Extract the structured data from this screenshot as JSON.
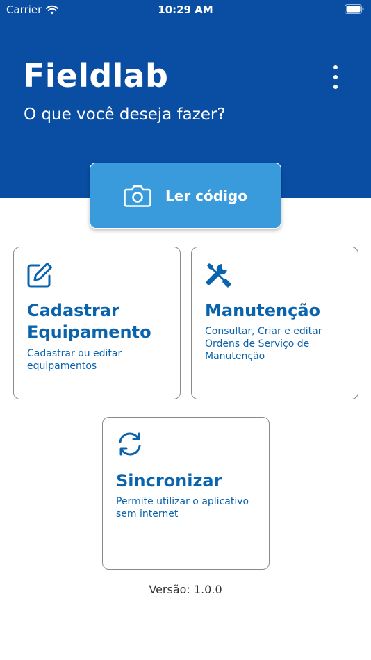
{
  "status_bar": {
    "carrier": "Carrier",
    "time": "10:29 AM"
  },
  "header": {
    "title": "Fieldlab",
    "subtitle": "O que você deseja fazer?"
  },
  "scan_button": {
    "label": "Ler código",
    "icon": "camera-icon"
  },
  "cards": {
    "register": {
      "title_line1": "Cadastrar",
      "title_line2": "Equipamento",
      "desc_line1": "Cadastrar ou editar",
      "desc_line2": "equipamentos",
      "icon": "edit-icon"
    },
    "maintenance": {
      "title": "Manutenção",
      "desc_line1": "Consultar, Criar e editar",
      "desc_line2": "Ordens de Serviço de",
      "desc_line3": "Manutenção",
      "icon": "tools-icon"
    },
    "sync": {
      "title": "Sincronizar",
      "desc_line1": "Permite utilizar o aplicativo",
      "desc_line2": "sem internet",
      "icon": "sync-icon"
    }
  },
  "footer": {
    "version": "Versão: 1.0.0"
  },
  "colors": {
    "header_bg": "#0a4ea3",
    "button_bg": "#3a9bdc",
    "accent": "#0a63ad"
  }
}
